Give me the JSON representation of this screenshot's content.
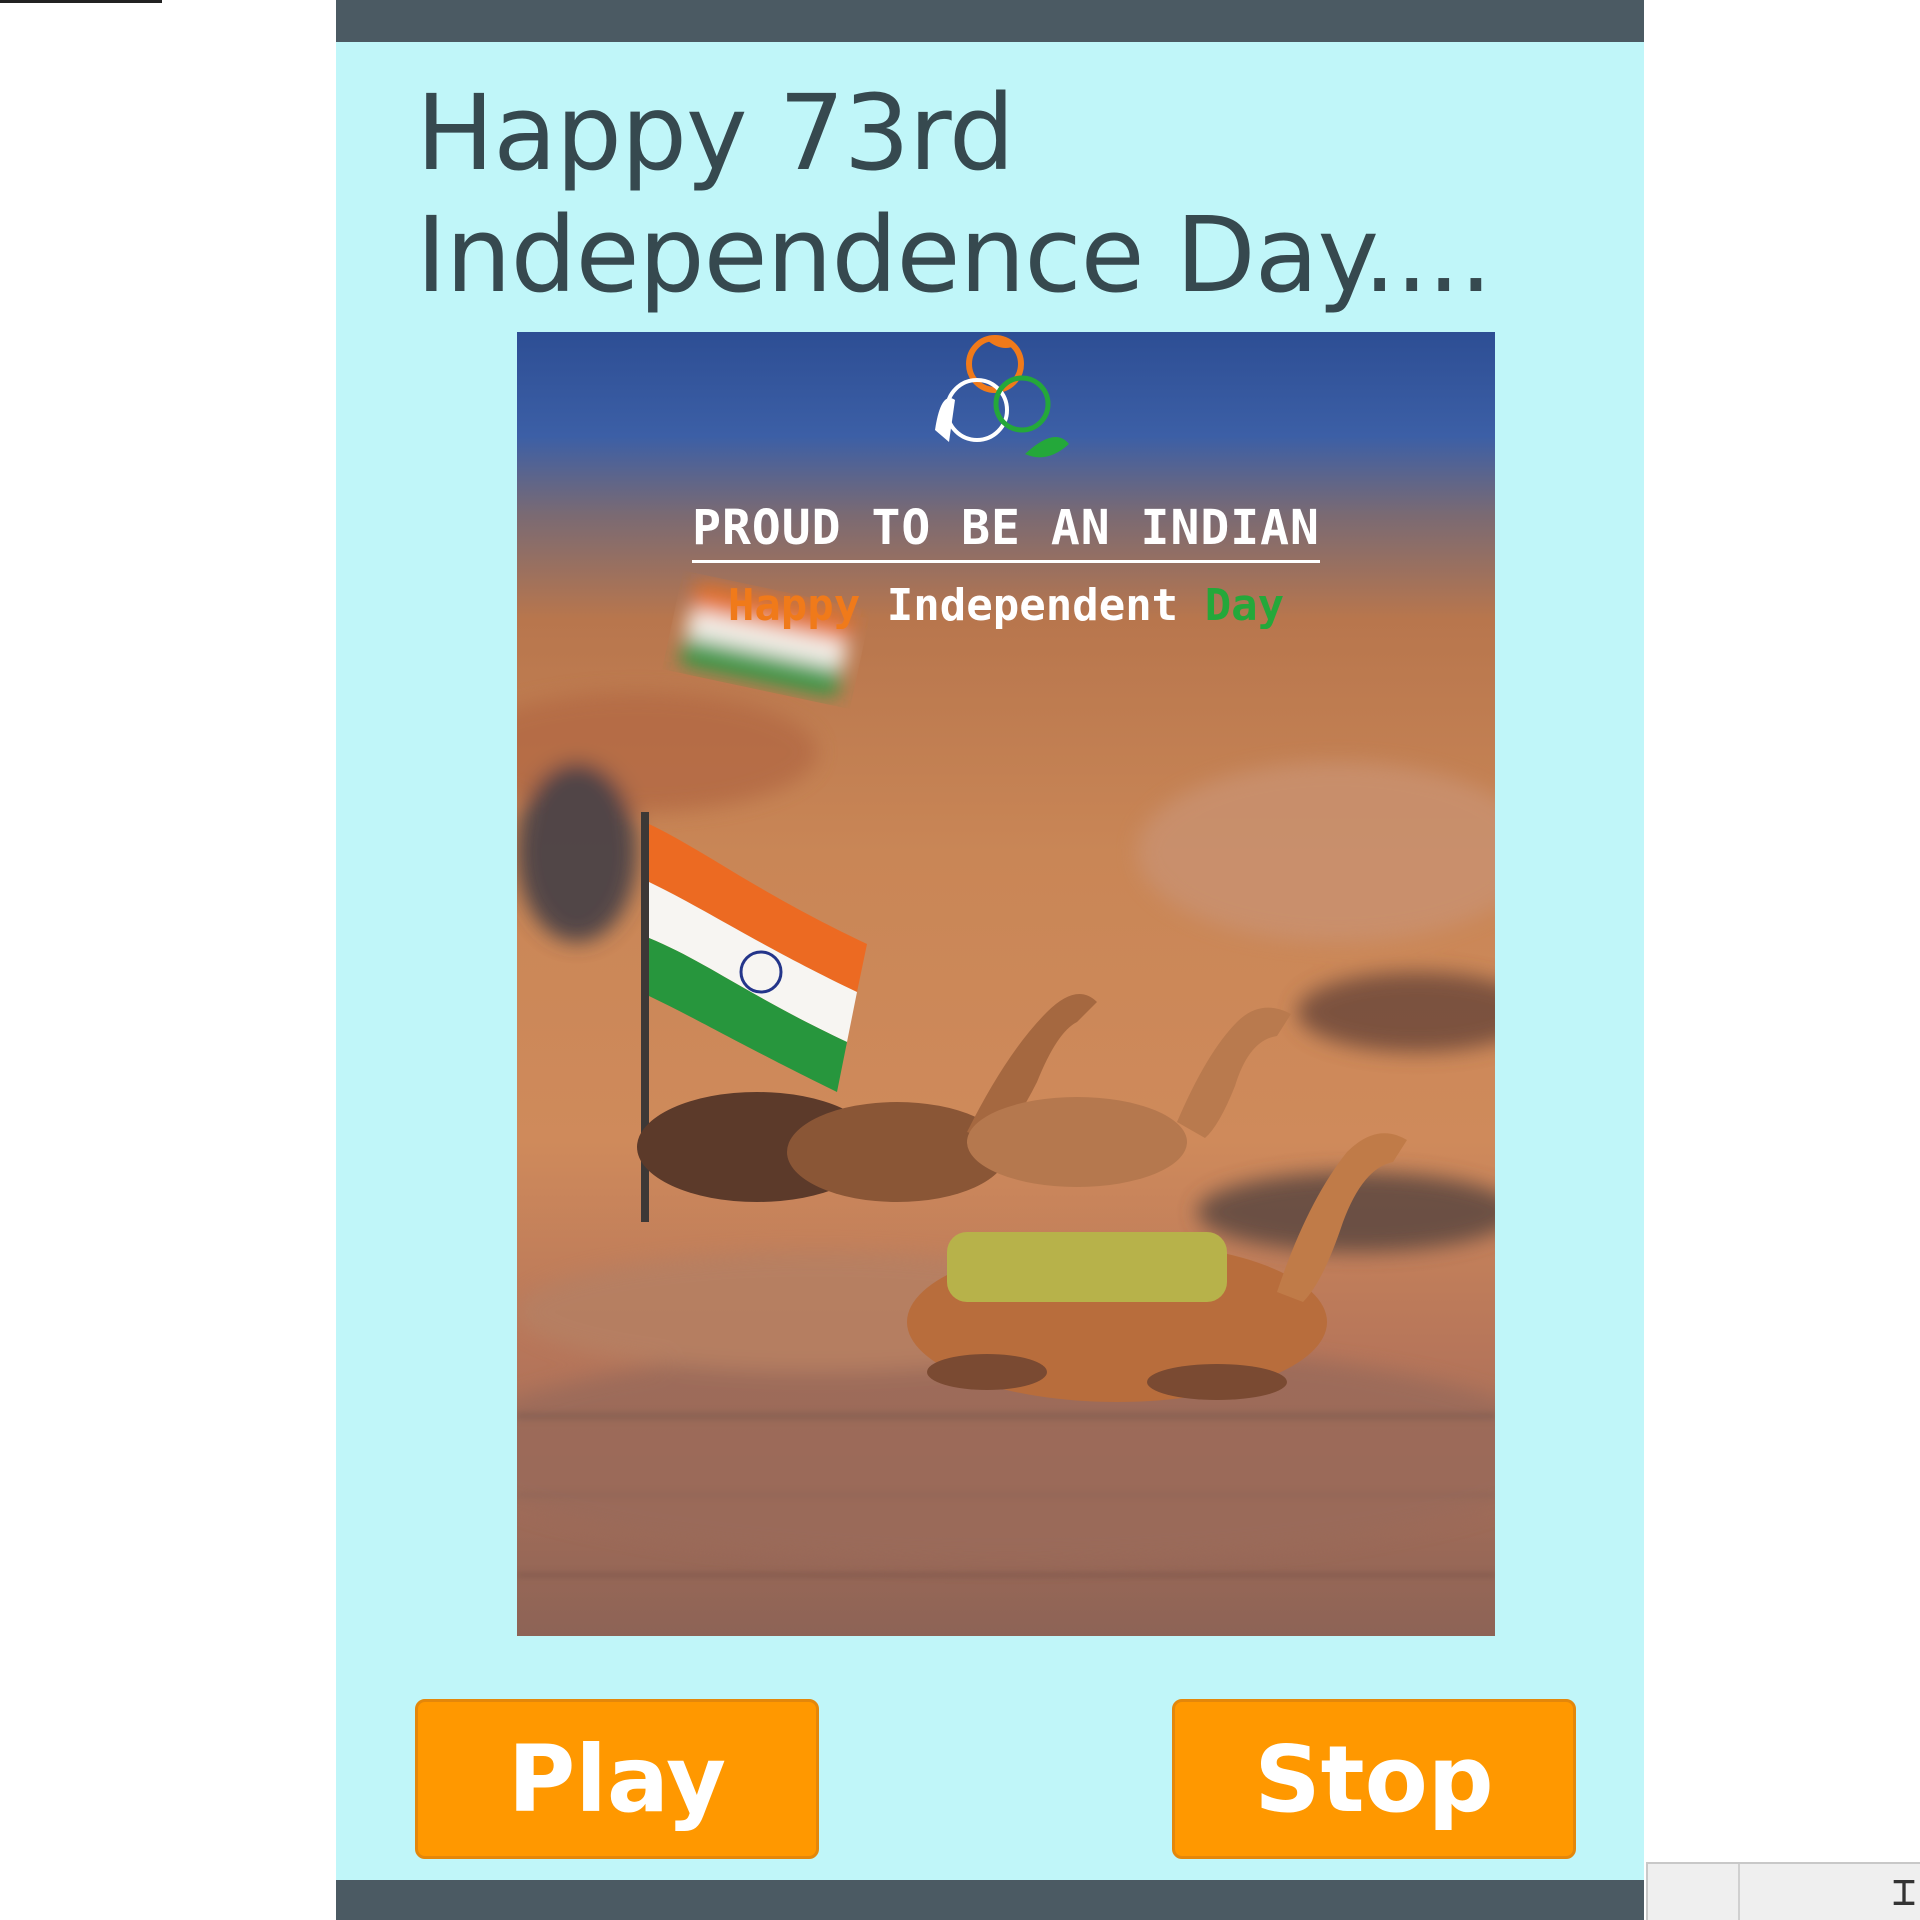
{
  "app": {
    "title": "Happy 73rd Independence Day....",
    "title_line1": "Happy 73rd",
    "title_line2": "Independence Day...."
  },
  "poster": {
    "headline": "PROUD TO BE AN INDIAN",
    "greeting_words": [
      "Happy",
      "Independent",
      "Day"
    ]
  },
  "controls": {
    "play_label": "Play",
    "stop_label": "Stop"
  },
  "colors": {
    "screen_background": "#c0f6f9",
    "frame": "#4b5a63",
    "title_text": "#36494f",
    "button": "#ff9800",
    "saffron": "#f07a1a",
    "green": "#24a83a"
  },
  "icons": {
    "cursor": "text-cursor-icon",
    "logo": "tricolor-circles-logo-icon"
  }
}
